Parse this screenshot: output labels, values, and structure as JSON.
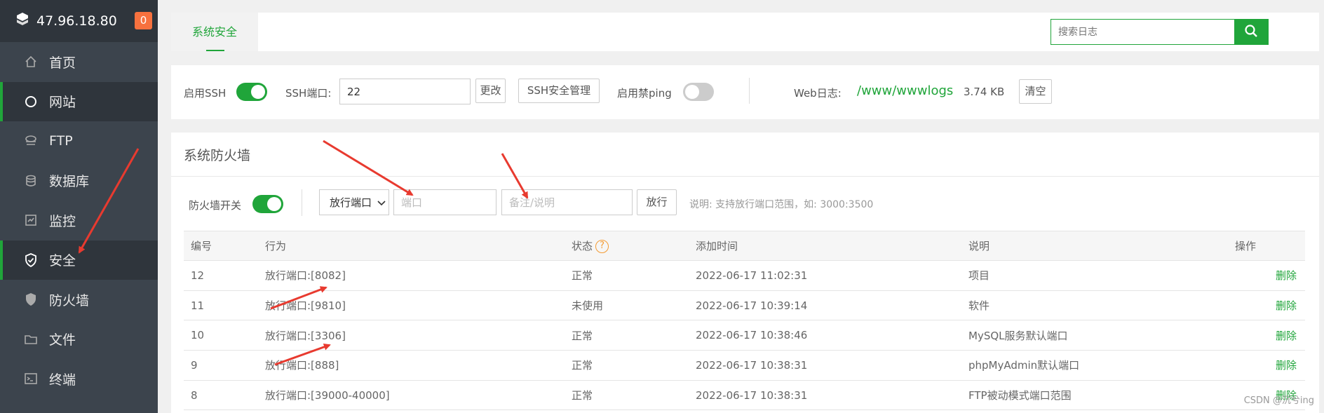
{
  "sidebar": {
    "host": "47.96.18.80",
    "badge": "0",
    "items": [
      {
        "label": "首页",
        "icon": "home-icon"
      },
      {
        "label": "网站",
        "icon": "globe-icon"
      },
      {
        "label": "FTP",
        "icon": "ftp-server-icon"
      },
      {
        "label": "数据库",
        "icon": "database-icon"
      },
      {
        "label": "监控",
        "icon": "monitor-icon"
      },
      {
        "label": "安全",
        "icon": "shield-check-icon"
      },
      {
        "label": "防火墙",
        "icon": "firewall-shield-icon"
      },
      {
        "label": "文件",
        "icon": "folder-icon"
      },
      {
        "label": "终端",
        "icon": "terminal-icon"
      }
    ]
  },
  "tabs": {
    "active": "系统安全"
  },
  "search": {
    "placeholder": "搜索日志"
  },
  "ssh": {
    "enable_label": "启用SSH",
    "port_label": "SSH端口:",
    "port_value": "22",
    "change_btn": "更改",
    "manage_btn": "SSH安全管理",
    "ping_label": "启用禁ping",
    "weblog_label": "Web日志:",
    "weblog_path": "/www/wwwlogs",
    "weblog_size": "3.74 KB",
    "clear_btn": "清空"
  },
  "firewall": {
    "title": "系统防火墙",
    "switch_label": "防火墙开关",
    "select_value": "放行端口",
    "port_placeholder": "端口",
    "remark_placeholder": "备注/说明",
    "allow_btn": "放行",
    "hint": "说明: 支持放行端口范围，如: 3000:3500",
    "columns": [
      "编号",
      "行为",
      "状态",
      "添加时间",
      "说明",
      "操作"
    ],
    "rows": [
      [
        "12",
        "放行端口:[8082]",
        "正常",
        "2022-06-17 11:02:31",
        "项目",
        "删除"
      ],
      [
        "11",
        "放行端口:[9810]",
        "未使用",
        "2022-06-17 10:39:14",
        "软件",
        "删除"
      ],
      [
        "10",
        "放行端口:[3306]",
        "正常",
        "2022-06-17 10:38:46",
        "MySQL服务默认端口",
        "删除"
      ],
      [
        "9",
        "放行端口:[888]",
        "正常",
        "2022-06-17 10:38:31",
        "phpMyAdmin默认端口",
        "删除"
      ],
      [
        "8",
        "放行端口:[39000-40000]",
        "正常",
        "2022-06-17 10:38:31",
        "FTP被动模式端口范围",
        "删除"
      ]
    ]
  },
  "watermark": "CSDN @沉兮ing",
  "colors": {
    "accent": "#20a53a",
    "sidebar": "#3c444d",
    "badge": "#f7713e",
    "annotation": "#e83a2f"
  }
}
